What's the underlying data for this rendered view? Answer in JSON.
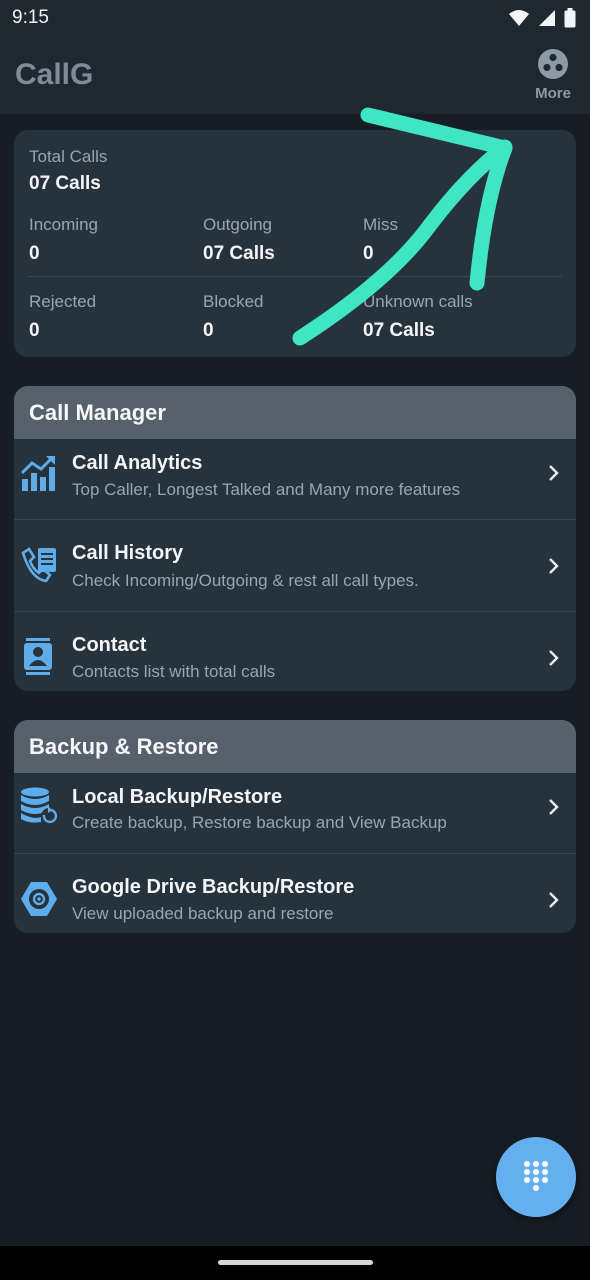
{
  "status_bar": {
    "time": "9:15"
  },
  "app_bar": {
    "title": "CallG",
    "more_label": "More"
  },
  "stats": {
    "total_label": "Total Calls",
    "total_value": "07 Calls",
    "incoming_label": "Incoming",
    "incoming_value": "0",
    "outgoing_label": "Outgoing",
    "outgoing_value": "07 Calls",
    "missed_label": "Miss",
    "missed_value": "0",
    "rejected_label": "Rejected",
    "rejected_value": "0",
    "blocked_label": "Blocked",
    "blocked_value": "0",
    "unknown_label": "Unknown calls",
    "unknown_value": "07 Calls"
  },
  "call_manager": {
    "header": "Call Manager",
    "items": [
      {
        "title": "Call Analytics",
        "subtitle": "Top Caller, Longest Talked and Many more features",
        "icon": "analytics-chart-icon"
      },
      {
        "title": "Call History",
        "subtitle": "Check Incoming/Outgoing & rest all call types.",
        "icon": "call-history-icon"
      },
      {
        "title": "Contact",
        "subtitle": "Contacts list with total calls",
        "icon": "contact-card-icon"
      }
    ]
  },
  "backup_restore": {
    "header": "Backup & Restore",
    "items": [
      {
        "title": "Local Backup/Restore",
        "subtitle": "Create backup, Restore backup and View Backup",
        "icon": "database-restore-icon"
      },
      {
        "title": "Google Drive Backup/Restore",
        "subtitle": "View uploaded backup and restore",
        "icon": "drive-backup-icon"
      }
    ]
  },
  "colors": {
    "background": "#161d24",
    "card": "#26323c",
    "section_header": "#56616c",
    "accent_blue": "#64b0ef",
    "annotation_arrow": "#3ee6c4"
  },
  "fab": {
    "icon": "dialpad-icon"
  }
}
